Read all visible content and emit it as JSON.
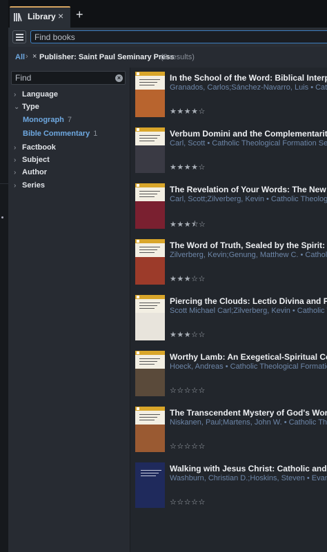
{
  "tab": {
    "title": "Library",
    "close": "×",
    "new_tab": "+"
  },
  "toolbar": {
    "search_placeholder": "Find books"
  },
  "breadcrumb": {
    "all": "All",
    "separator": "›",
    "remove": "×",
    "filter": "Publisher: Saint Paul Seminary Press",
    "count": "(8 results)"
  },
  "sidebar": {
    "find_placeholder": "Find",
    "clear": "×",
    "facets": [
      {
        "label": "Language",
        "chevron": "›"
      },
      {
        "label": "Type",
        "chevron": "⌄"
      },
      {
        "label": "Factbook",
        "chevron": "›"
      },
      {
        "label": "Subject",
        "chevron": "›"
      },
      {
        "label": "Author",
        "chevron": "›"
      },
      {
        "label": "Series",
        "chevron": "›"
      }
    ],
    "type_values": [
      {
        "label": "Monograph",
        "count": "7"
      },
      {
        "label": "Bible Commentary",
        "count": "1"
      }
    ]
  },
  "books": [
    {
      "title": "In the School of the Word: Biblical Interpretation",
      "meta": "Granados, Carlos;Sánchez-Navarro, Luis • Catholic Theological Formation Series",
      "stars": "★★★★☆",
      "rating": 4,
      "band": "#d9a62a",
      "paper": "#f3efe3",
      "art": "#b8642e"
    },
    {
      "title": "Verbum Domini and the Complementarity of Exegesis and Theology",
      "meta": "Carl, Scott • Catholic Theological Formation Series",
      "stars": "★★★★☆",
      "rating": 4,
      "band": "#d9a62a",
      "paper": "#f3efe3",
      "art": "#3a3a44"
    },
    {
      "title": "The Revelation of Your Words: The New Evangelization",
      "meta": "Carl, Scott;Zilverberg, Kevin • Catholic Theological Formation Series",
      "stars": "★★★⯪☆",
      "rating": 3.5,
      "band": "#d9a62a",
      "paper": "#f3efe3",
      "art": "#7a2030"
    },
    {
      "title": "The Word of Truth, Sealed by the Spirit: Perspectives",
      "meta": "Zilverberg, Kevin;Genung, Matthew C. • Catholic Theological Formation Series",
      "stars": "★★★☆☆",
      "rating": 3,
      "band": "#d9a62a",
      "paper": "#f3efe3",
      "art": "#9c3b2a"
    },
    {
      "title": "Piercing the Clouds: Lectio Divina and Preparation for Ministry",
      "meta": "Scott Michael Carl;Zilverberg, Kevin • Catholic Theological Formation Series",
      "stars": "★★★☆☆",
      "rating": 3,
      "band": "#d9a62a",
      "paper": "#f3efe3",
      "art": "#e8e4dc"
    },
    {
      "title": "Worthy Lamb: An Exegetical-Spiritual Commentary",
      "meta": "Hoeck, Andreas • Catholic Theological Formation Series",
      "stars": "☆☆☆☆☆",
      "rating": 0,
      "band": "#d9a62a",
      "paper": "#f3efe3",
      "art": "#5a4a3a"
    },
    {
      "title": "The Transcendent Mystery of God's Word: Apophatic",
      "meta": "Niskanen, Paul;Martens, John W. • Catholic Theological Formation Series",
      "stars": "☆☆☆☆☆",
      "rating": 0,
      "band": "#d9a62a",
      "paper": "#f3efe3",
      "art": "#9a5a32"
    },
    {
      "title": "Walking with Jesus Christ: Catholic and Evangelical",
      "meta": "Washburn, Christian D.;Hoskins, Steven • Evangelical",
      "stars": "☆☆☆☆☆",
      "rating": 0,
      "band": "#1f2a5c",
      "paper": "#1f2a5c",
      "art": "#1f2a5c"
    }
  ]
}
